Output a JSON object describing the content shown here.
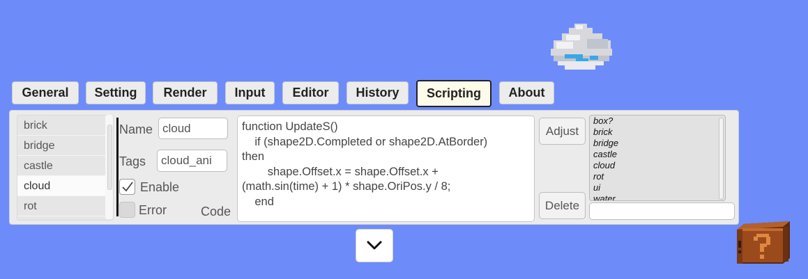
{
  "tabs": [
    {
      "label": "General"
    },
    {
      "label": "Setting"
    },
    {
      "label": "Render"
    },
    {
      "label": "Input"
    },
    {
      "label": "Editor"
    },
    {
      "label": "History"
    },
    {
      "label": "Scripting"
    },
    {
      "label": "About"
    }
  ],
  "active_tab": "Scripting",
  "shapes_list": {
    "items": [
      "brick",
      "bridge",
      "castle",
      "cloud",
      "rot"
    ],
    "selected": "cloud"
  },
  "form": {
    "name_label": "Name",
    "name_value": "cloud",
    "tags_label": "Tags",
    "tags_value": "cloud_ani",
    "enable_label": "Enable",
    "enable_checked": true,
    "error_label": "Error",
    "error_checked": false,
    "code_label": "Code",
    "code_value": "function UpdateS()\n    if (shape2D.Completed or shape2D.AtBorder)\nthen\n        shape.Offset.x = shape.Offset.x +\n(math.sin(time) + 1) * shape.OriPos.y / 8;\n    end"
  },
  "buttons": {
    "adjust": "Adjust",
    "delete": "Delete"
  },
  "tag_list": {
    "items": [
      "box?",
      "brick",
      "bridge",
      "castle",
      "cloud",
      "rot",
      "ui",
      "water"
    ]
  },
  "tag_input_value": "",
  "icons": {
    "expand": "chevron-down-icon",
    "checkmark": "checkmark-icon"
  },
  "colors": {
    "background": "#6d8cfa",
    "panel": "#ebebeb",
    "active_tab_border": "#222222"
  }
}
